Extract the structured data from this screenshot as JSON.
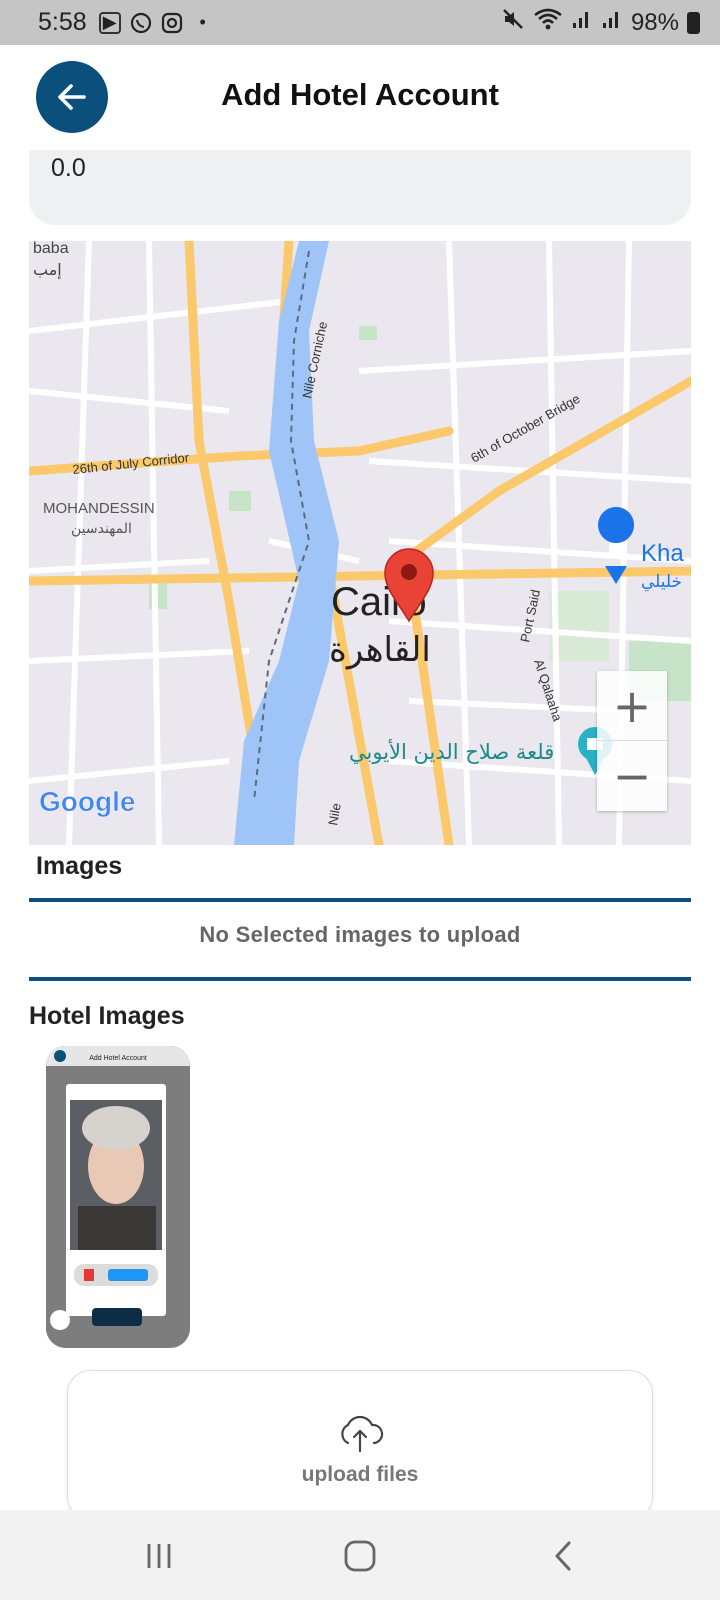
{
  "status_bar": {
    "time": "5:58",
    "battery": "98%",
    "left_icons": [
      "media-icon",
      "whatsapp-icon",
      "instagram-icon",
      "dot-icon"
    ],
    "right_icons": [
      "mute-icon",
      "wifi-icon",
      "signal-icon",
      "signal-icon",
      "battery-icon"
    ]
  },
  "app_bar": {
    "title": "Add Hotel Account"
  },
  "form": {
    "rating_value": "0.0"
  },
  "map": {
    "city_en": "Cairo",
    "city_ar": "القاهرة",
    "district_en": "MOHANDESSIN",
    "district_ar": "المهندسين",
    "roads": [
      "26th of July Corridor",
      "Nile Corniche",
      "6th of October Bridge",
      "Port Said",
      "Al Qalaaha",
      "Nile"
    ],
    "poi_ar": "قلعة صلاح الدين الأيوبي",
    "poi_kha": "Kha",
    "poi_kha_ar": "خليلي",
    "imbaba_en": "baba",
    "imbaba_ar": "إمب",
    "provider": "Google",
    "zoom_in": "+",
    "zoom_out": "−"
  },
  "images_section": {
    "label": "Images",
    "empty_message": "No Selected images to upload"
  },
  "hotel_images": {
    "label": "Hotel Images",
    "thumb_title": "Add Hotel Account"
  },
  "upload": {
    "label": "upload files"
  },
  "colors": {
    "primary": "#0b4f7c",
    "map_water": "#9fc5f8",
    "map_highway": "#fbc96b",
    "marker": "#ea4335"
  }
}
